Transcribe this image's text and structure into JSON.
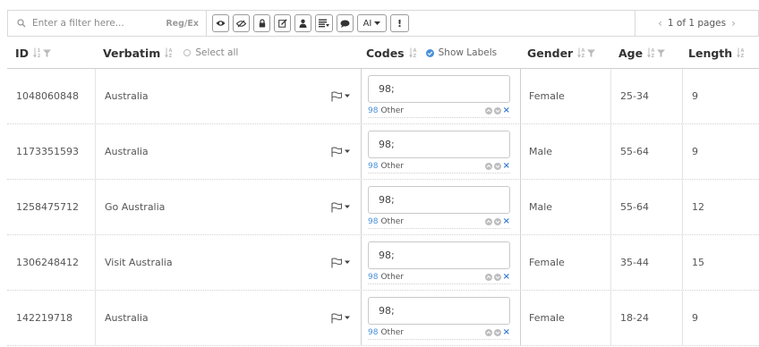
{
  "toolbar": {
    "filter_placeholder": "Enter a filter here...",
    "regex_label": "Reg/Ex",
    "buttons": [
      "eye-icon",
      "eye-slash-icon",
      "lock-icon",
      "edit-icon",
      "user-icon",
      "list-filter-icon",
      "comment-icon"
    ],
    "ai_label": "AI",
    "bang_label": "!",
    "pager_text": "1 of 1 pages"
  },
  "columns": {
    "id": "ID",
    "verbatim": "Verbatim",
    "select_all": "Select all",
    "codes": "Codes",
    "show_labels": "Show Labels",
    "gender": "Gender",
    "age": "Age",
    "length": "Length"
  },
  "rows": [
    {
      "id": "1048060848",
      "verbatim": "Australia",
      "code_value": "98;",
      "code_num": "98",
      "code_label": "Other",
      "gender": "Female",
      "age": "25-34",
      "length": "9"
    },
    {
      "id": "1173351593",
      "verbatim": "Australia",
      "code_value": "98;",
      "code_num": "98",
      "code_label": "Other",
      "gender": "Male",
      "age": "55-64",
      "length": "9"
    },
    {
      "id": "1258475712",
      "verbatim": "Go Australia",
      "code_value": "98;",
      "code_num": "98",
      "code_label": "Other",
      "gender": "Male",
      "age": "55-64",
      "length": "12"
    },
    {
      "id": "1306248412",
      "verbatim": "Visit Australia",
      "code_value": "98;",
      "code_num": "98",
      "code_label": "Other",
      "gender": "Female",
      "age": "35-44",
      "length": "15"
    },
    {
      "id": "142219718",
      "verbatim": "Australia",
      "code_value": "98;",
      "code_num": "98",
      "code_label": "Other",
      "gender": "Female",
      "age": "18-24",
      "length": "9"
    }
  ],
  "colors": {
    "accent": "#4a90d9",
    "border": "#d9d9d9",
    "remove_x": "#3a7fd5"
  }
}
